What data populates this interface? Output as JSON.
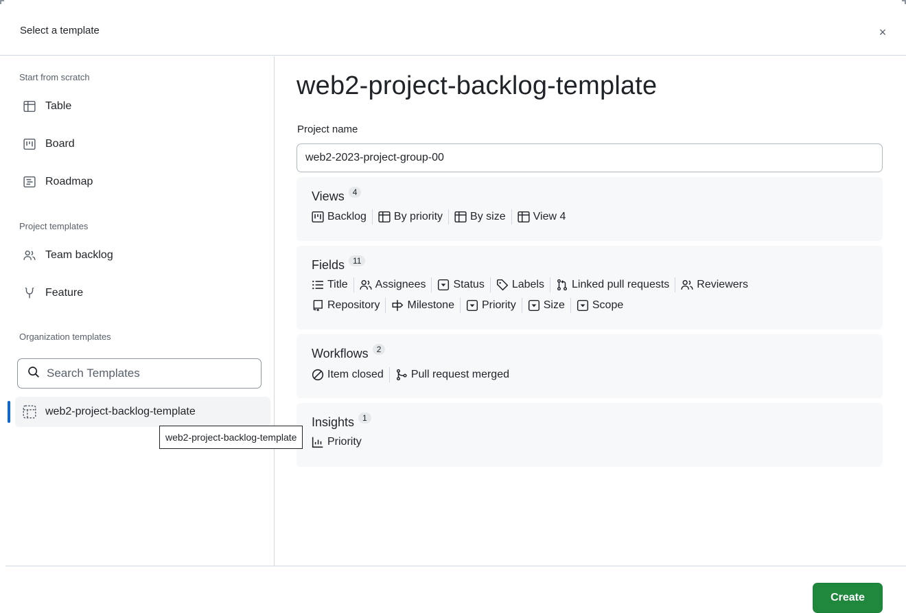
{
  "dialog": {
    "title": "Select a template",
    "close_icon": "×"
  },
  "sidebar": {
    "scratch_label": "Start from scratch",
    "scratch_items": [
      {
        "label": "Table",
        "icon": "table-icon"
      },
      {
        "label": "Board",
        "icon": "board-icon"
      },
      {
        "label": "Roadmap",
        "icon": "roadmap-icon"
      }
    ],
    "project_templates_label": "Project templates",
    "project_templates": [
      {
        "label": "Team backlog",
        "icon": "people-icon"
      },
      {
        "label": "Feature",
        "icon": "feature-icon"
      }
    ],
    "org_templates_label": "Organization templates",
    "search_placeholder": "Search Templates",
    "org_templates": [
      {
        "label": "web2-project-backlog-template",
        "icon": "template-icon",
        "selected": true
      }
    ],
    "tooltip": "web2-project-backlog-template"
  },
  "main": {
    "title": "web2-project-backlog-template",
    "project_name_label": "Project name",
    "project_name_value": "web2-2023-project-group-00",
    "views": {
      "title": "Views",
      "count": "4",
      "items": [
        {
          "label": "Backlog",
          "icon": "board-icon"
        },
        {
          "label": "By priority",
          "icon": "table-icon"
        },
        {
          "label": "By size",
          "icon": "table-icon"
        },
        {
          "label": "View 4",
          "icon": "table-icon"
        }
      ]
    },
    "fields": {
      "title": "Fields",
      "count": "11",
      "row1": [
        {
          "label": "Title",
          "icon": "list-icon"
        },
        {
          "label": "Assignees",
          "icon": "people-icon"
        },
        {
          "label": "Status",
          "icon": "single-select-icon"
        },
        {
          "label": "Labels",
          "icon": "tag-icon"
        },
        {
          "label": "Linked pull requests",
          "icon": "pull-request-icon"
        },
        {
          "label": "Reviewers",
          "icon": "people-icon"
        }
      ],
      "row2": [
        {
          "label": "Repository",
          "icon": "repo-icon"
        },
        {
          "label": "Milestone",
          "icon": "milestone-icon"
        },
        {
          "label": "Priority",
          "icon": "single-select-icon"
        },
        {
          "label": "Size",
          "icon": "single-select-icon"
        },
        {
          "label": "Scope",
          "icon": "single-select-icon"
        }
      ]
    },
    "workflows": {
      "title": "Workflows",
      "count": "2",
      "items": [
        {
          "label": "Item closed",
          "icon": "circle-slash-icon"
        },
        {
          "label": "Pull request merged",
          "icon": "git-merge-icon"
        }
      ]
    },
    "insights": {
      "title": "Insights",
      "count": "1",
      "items": [
        {
          "label": "Priority",
          "icon": "graph-icon"
        }
      ]
    }
  },
  "footer": {
    "create_label": "Create",
    "create_color": "#1f883d"
  },
  "colors": {
    "accent": "#0969da",
    "border": "#d0d7de",
    "card_bg": "#f6f8fa"
  }
}
